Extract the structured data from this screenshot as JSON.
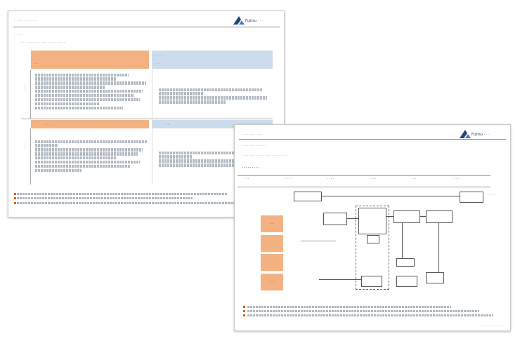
{
  "slide1": {
    "breadcrumb": "· · · · · · · · · · · ·",
    "logo_text": "Fujitsu · · ·",
    "section_title": "· · · · · ·",
    "intro": "· · · · · · · · · · · · · · · · · · · · · · · · ·",
    "col1_header": "· · · ·",
    "col1_sub": "· · ·",
    "col2_header": "· · · ·",
    "col2_sub": "· · ·",
    "row1_label": "· · · ·",
    "row2_header1": "· · ·",
    "row2_header2": "· · ·",
    "row2_label": "· · · ·",
    "footer": "· · · · · · · · · · · · · · ·"
  },
  "slide2": {
    "breadcrumb": "· · · · · · · · · · · ·",
    "logo_text": "Fujitsu · · ·",
    "title": "· · · · · · · · · · · · · ·",
    "subtitle": "· · · · · · · · · · · · · · · · · · · · · · · · · ·",
    "diagram_title": "· · · · · · · · ·",
    "phases": [
      "· · ·",
      "· · · ·",
      "· · · ·",
      "· · · ·",
      "· · ·",
      "· · · ·"
    ],
    "row_labels": [
      "· · ·",
      "· · · ·",
      "· · · ·",
      "· · · ·"
    ],
    "red_note": "· · · · · ·",
    "footer": "· · · · · · · · · · · · · · ·"
  },
  "colors": {
    "accent_orange": "#f4b283",
    "accent_blue": "#ccdcec",
    "logo_blue": "#24437a",
    "bullet_red": "#d9600e"
  }
}
